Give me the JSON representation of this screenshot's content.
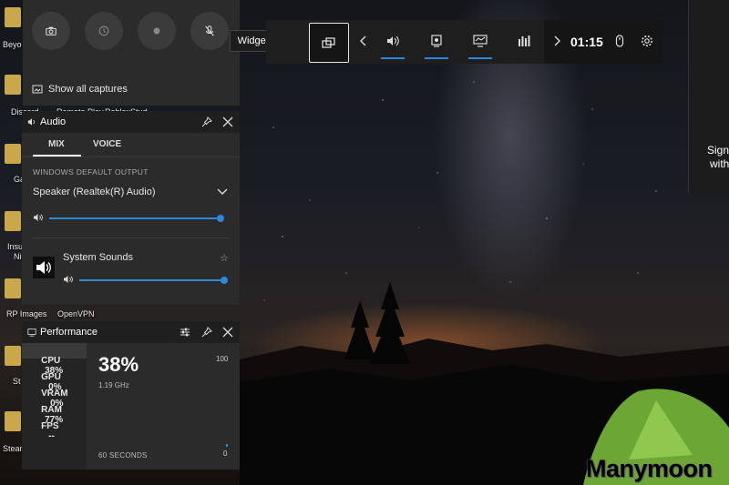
{
  "desktop": {
    "labels": [
      "Beyo",
      "Discord",
      "Ga",
      "Insu",
      "Ni",
      "RP Images",
      "OpenVPN",
      "St",
      "Steam"
    ],
    "overlapped_labels": [
      "Remote Play",
      "RobloxStud"
    ]
  },
  "tooltip": {
    "text": "Widget Menu"
  },
  "capture": {
    "buttons": [
      "camera-icon",
      "record-last-icon",
      "record-icon",
      "mic-off-icon"
    ],
    "show_all_label": "Show all captures"
  },
  "topbar": {
    "time": "01:15",
    "widgets": [
      "audio-icon",
      "capture-icon",
      "performance-icon",
      "resources-icon"
    ]
  },
  "right_panel": {
    "sign_in_line1": "Sign",
    "sign_in_line2": "with"
  },
  "audio": {
    "title": "Audio",
    "tabs": [
      "MIX",
      "VOICE"
    ],
    "section_label": "WINDOWS DEFAULT OUTPUT",
    "device": "Speaker (Realtek(R) Audio)",
    "master_volume": 1.0,
    "app": {
      "name": "System Sounds",
      "volume": 1.0
    }
  },
  "performance": {
    "title": "Performance",
    "rows": [
      {
        "label": "CPU",
        "value": "38%"
      },
      {
        "label": "GPU",
        "value": "0%"
      },
      {
        "label": "VRAM",
        "value": "0%"
      },
      {
        "label": "RAM",
        "value": "77%"
      },
      {
        "label": "FPS",
        "value": "--"
      }
    ],
    "selected_value": "38%",
    "frequency": "1.19 GHz",
    "max_label": "100",
    "min_label": "0",
    "duration_label": "60 SECONDS"
  },
  "watermark": "Manymoon",
  "colors": {
    "accent": "#2f89d8",
    "panel": "#2b2b2b",
    "header": "#1f1f1f"
  }
}
